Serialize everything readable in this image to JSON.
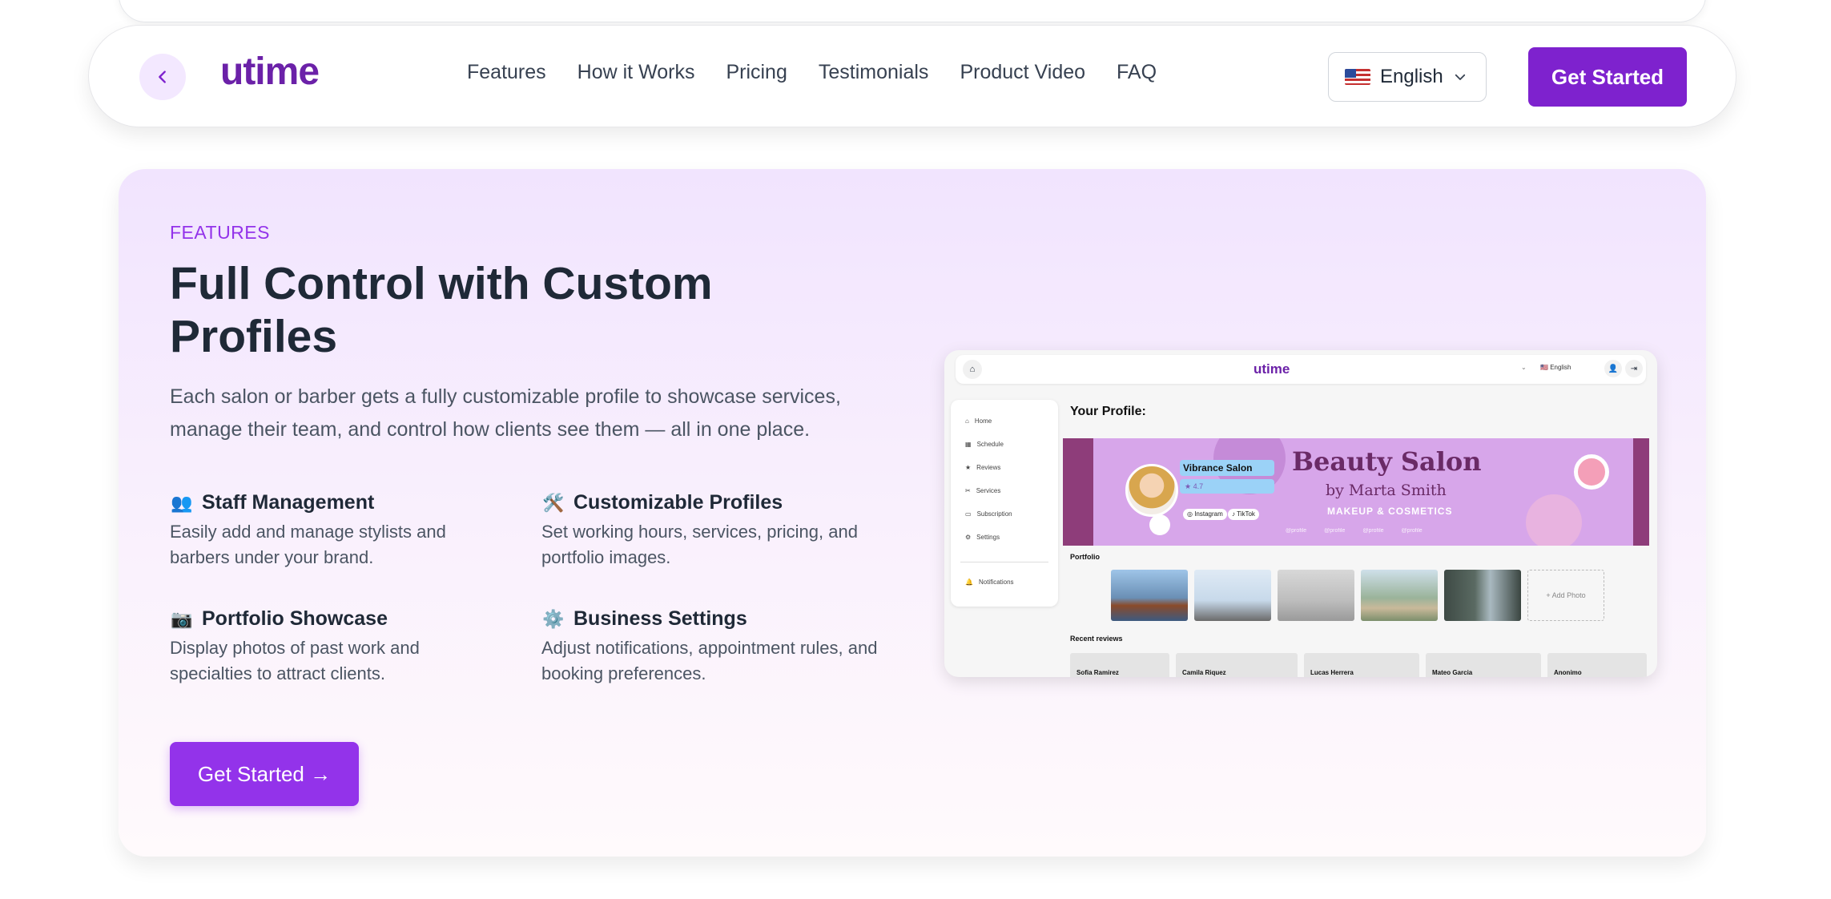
{
  "nav": {
    "logo": "utime",
    "links": [
      "Features",
      "How it Works",
      "Pricing",
      "Testimonials",
      "Product Video",
      "FAQ"
    ],
    "language": "English",
    "cta": "Get Started"
  },
  "features": {
    "eyebrow": "FEATURES",
    "headline": "Full Control with Custom Profiles",
    "lede": "Each salon or barber gets a fully customizable profile to showcase services, manage their team, and control how clients see them — all in one place.",
    "items": [
      {
        "icon": "👥",
        "title": "Staff Management",
        "desc": "Easily add and manage stylists and barbers under your brand."
      },
      {
        "icon": "🛠️",
        "title": "Customizable Profiles",
        "desc": "Set working hours, services, pricing, and portfolio images."
      },
      {
        "icon": "📷",
        "title": "Portfolio Showcase",
        "desc": "Display photos of past work and specialties to attract clients."
      },
      {
        "icon": "⚙️",
        "title": "Business Settings",
        "desc": "Adjust notifications, appointment rules, and booking preferences."
      }
    ],
    "cta": "Get Started →"
  },
  "mockup": {
    "logo": "utime",
    "language": "English",
    "sidebar": [
      "Home",
      "Schedule",
      "Reviews",
      "Services",
      "Subscription",
      "Settings",
      "Notifications"
    ],
    "page_title": "Your Profile:",
    "salon_name": "Vibrance Salon",
    "rating": "4.7",
    "social": [
      "Instagram",
      "TikTok"
    ],
    "banner_title": "Beauty Salon",
    "banner_subtitle": "by Marta Smith",
    "banner_tagline": "MAKEUP & COSMETICS",
    "banner_handles": [
      "@profile",
      "@profile",
      "@profile",
      "@profile"
    ],
    "portfolio_label": "Portfolio",
    "add_photo": "+ Add Photo",
    "reviews_label": "Recent reviews",
    "reviewers": [
      "Sofia Ramirez",
      "Camila Riquez",
      "Lucas Herrera",
      "Mateo Garcia",
      "Anonimo"
    ]
  }
}
